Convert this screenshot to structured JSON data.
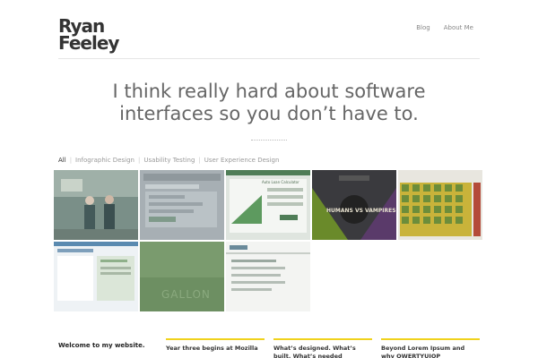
{
  "logo": {
    "line1": "Ryan",
    "line2": "Feeley"
  },
  "nav": {
    "items": [
      {
        "label": "Blog"
      },
      {
        "label": "About Me"
      }
    ]
  },
  "tagline": {
    "line1": "I think really hard about software",
    "line2": "interfaces so you don’t have to."
  },
  "filters": {
    "items": [
      {
        "label": "All",
        "active": true
      },
      {
        "label": "Infographic Design",
        "active": false
      },
      {
        "label": "Usability Testing",
        "active": false
      },
      {
        "label": "User Experience Design",
        "active": false
      }
    ]
  },
  "portfolio": {
    "tiles": [
      {
        "name": "portfolio-thumb-people-photo",
        "caption": ""
      },
      {
        "name": "portfolio-thumb-web-form",
        "caption": ""
      },
      {
        "name": "portfolio-thumb-loan-calculator",
        "caption": "Auto Loan Calculator"
      },
      {
        "name": "portfolio-thumb-humans-vampires",
        "caption": "HUMANS VS VAMPIRES"
      },
      {
        "name": "portfolio-thumb-spreadsheet-grid",
        "caption": ""
      },
      {
        "name": "portfolio-thumb-product-page",
        "caption": ""
      },
      {
        "name": "portfolio-thumb-gallon",
        "caption": "GALLON"
      },
      {
        "name": "portfolio-thumb-list-page",
        "caption": ""
      }
    ]
  },
  "intro": {
    "heading": "Welcome to my website.",
    "subtext": ""
  },
  "posts": [
    {
      "title": "Year three begins at Mozilla"
    },
    {
      "title": "What’s designed. What’s built. What’s needed"
    },
    {
      "title": "Beyond Lorem Ipsum and why QWERTYUIOP ASDFGHJKL is not"
    }
  ],
  "colors": {
    "accent": "#f0d21d",
    "text": "#555555",
    "heading": "#333333"
  }
}
